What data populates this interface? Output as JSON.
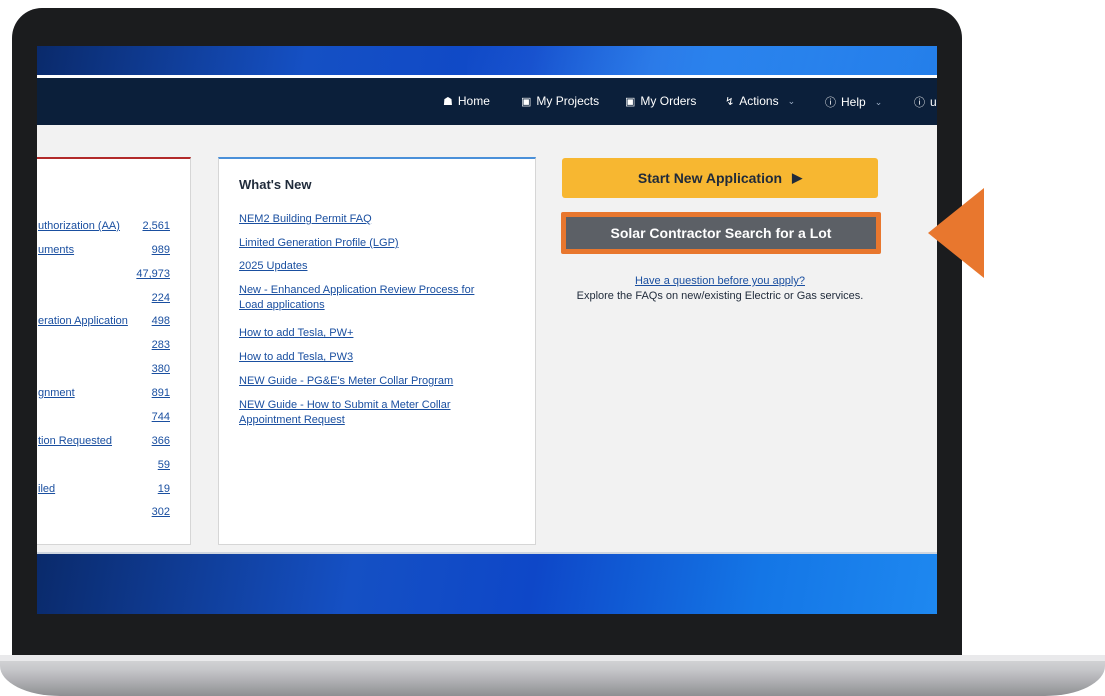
{
  "nav": {
    "home": "Home",
    "my_projects": "My Projects",
    "my_orders": "My Orders",
    "actions": "Actions",
    "help": "Help",
    "user": "u"
  },
  "stats": [
    {
      "label": "uthorization (AA)",
      "value": "2,561"
    },
    {
      "label": "uments",
      "value": "989"
    },
    {
      "label": "",
      "value": "47,973"
    },
    {
      "label": "",
      "value": "224"
    },
    {
      "label": "eration Application",
      "value": "498"
    },
    {
      "label": "",
      "value": "283"
    },
    {
      "label": "",
      "value": "380"
    },
    {
      "label": "gnment",
      "value": "891"
    },
    {
      "label": "",
      "value": "744"
    },
    {
      "label": "tion Requested",
      "value": "366"
    },
    {
      "label": "",
      "value": "59"
    },
    {
      "label": "iled",
      "value": "19"
    },
    {
      "label": "",
      "value": "302"
    }
  ],
  "whats_new": {
    "title": "What's New",
    "links": [
      "NEM2 Building Permit FAQ",
      "Limited Generation Profile (LGP)",
      "2025 Updates",
      "New - Enhanced Application Review Process for Load applications",
      "How to add Tesla, PW+",
      "How to add Tesla, PW3",
      "NEW Guide - PG&E's Meter Collar Program",
      "NEW Guide - How to Submit a Meter Collar Appointment Request"
    ]
  },
  "actions": {
    "start_new_application": "Start New Application",
    "solar_contractor_search": "Solar Contractor Search for a Lot",
    "question_link": "Have a question before you apply?",
    "faq_text": "Explore the FAQs on new/existing Electric or Gas services."
  },
  "colors": {
    "navbar": "#0b1f3a",
    "start_button": "#f7b731",
    "solar_button": "#5c6066",
    "highlight": "#e8772e",
    "link": "#1a4fa0"
  }
}
